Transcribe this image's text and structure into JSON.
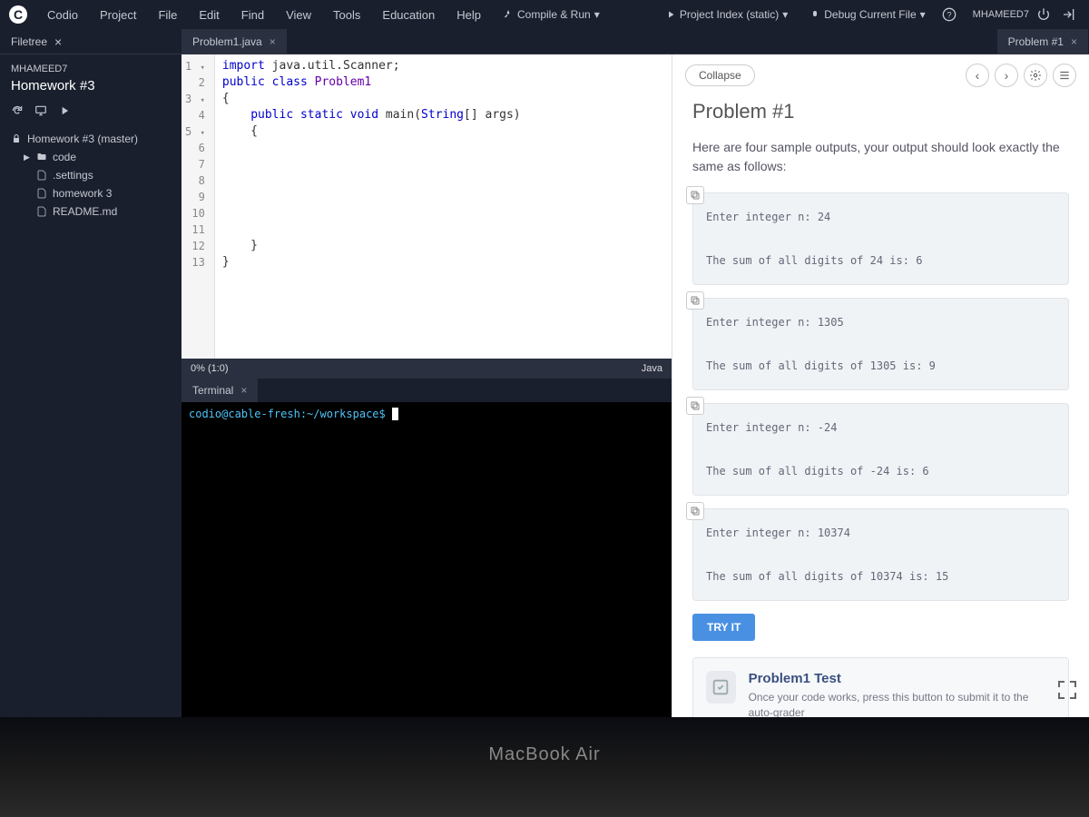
{
  "menubar": {
    "brand": "Codio",
    "items": [
      "Project",
      "File",
      "Edit",
      "Find",
      "View",
      "Tools",
      "Education",
      "Help"
    ],
    "compile_run": "Compile & Run",
    "project_index": "Project Index (static)",
    "debug_current": "Debug Current File",
    "username": "MHAMEED7"
  },
  "filetree_label": "Filetree",
  "editor_tab": "Problem1.java",
  "right_tab": "Problem #1",
  "sidebar": {
    "user": "MHAMEED7",
    "project_title": "Homework #3",
    "root": "Homework #3 (master)",
    "nodes": [
      {
        "label": "code",
        "kind": "folder"
      },
      {
        "label": ".settings",
        "kind": "file"
      },
      {
        "label": "homework 3",
        "kind": "file"
      },
      {
        "label": "README.md",
        "kind": "file"
      }
    ]
  },
  "code": {
    "lines": [
      {
        "n": "1",
        "fold": "▾",
        "segments": [
          {
            "t": "import ",
            "c": "kw"
          },
          {
            "t": "java.util.Scanner;",
            "c": ""
          }
        ]
      },
      {
        "n": "2",
        "fold": "",
        "segments": [
          {
            "t": "public class ",
            "c": "kw"
          },
          {
            "t": "Problem1",
            "c": "cls"
          }
        ]
      },
      {
        "n": "3",
        "fold": "▾",
        "segments": [
          {
            "t": "{",
            "c": ""
          }
        ]
      },
      {
        "n": "4",
        "fold": "",
        "segments": [
          {
            "t": "    ",
            "c": ""
          },
          {
            "t": "public static void ",
            "c": "kw"
          },
          {
            "t": "main(",
            "c": ""
          },
          {
            "t": "String",
            "c": "type"
          },
          {
            "t": "[] args)",
            "c": ""
          }
        ]
      },
      {
        "n": "5",
        "fold": "▾",
        "segments": [
          {
            "t": "    {",
            "c": ""
          }
        ]
      },
      {
        "n": "6",
        "fold": "",
        "segments": []
      },
      {
        "n": "7",
        "fold": "",
        "segments": []
      },
      {
        "n": "8",
        "fold": "",
        "segments": []
      },
      {
        "n": "9",
        "fold": "",
        "segments": []
      },
      {
        "n": "10",
        "fold": "",
        "segments": []
      },
      {
        "n": "11",
        "fold": "",
        "segments": []
      },
      {
        "n": "12",
        "fold": "",
        "segments": [
          {
            "t": "    }",
            "c": ""
          }
        ]
      },
      {
        "n": "13",
        "fold": "",
        "segments": [
          {
            "t": "}",
            "c": ""
          }
        ]
      }
    ],
    "status_left": "0% (1:0)",
    "status_right": "Java"
  },
  "terminal": {
    "tab": "Terminal",
    "prompt": "codio@cable-fresh:~/workspace$ "
  },
  "guide": {
    "collapse": "Collapse",
    "heading": "Problem #1",
    "intro": "Here are four sample outputs, your output should look exactly the same as follows:",
    "samples": [
      "Enter integer n: 24\n\nThe sum of all digits of 24 is: 6",
      "Enter integer n: 1305\n\nThe sum of all digits of 1305 is: 9",
      "Enter integer n: -24\n\nThe sum of all digits of -24 is: 6",
      "Enter integer n: 10374\n\nThe sum of all digits of 10374 is: 15"
    ],
    "try_it": "TRY IT",
    "test_title": "Problem1 Test",
    "test_desc": "Once your code works, press this button to submit it to the auto-grader"
  },
  "laptop": "MacBook Air"
}
